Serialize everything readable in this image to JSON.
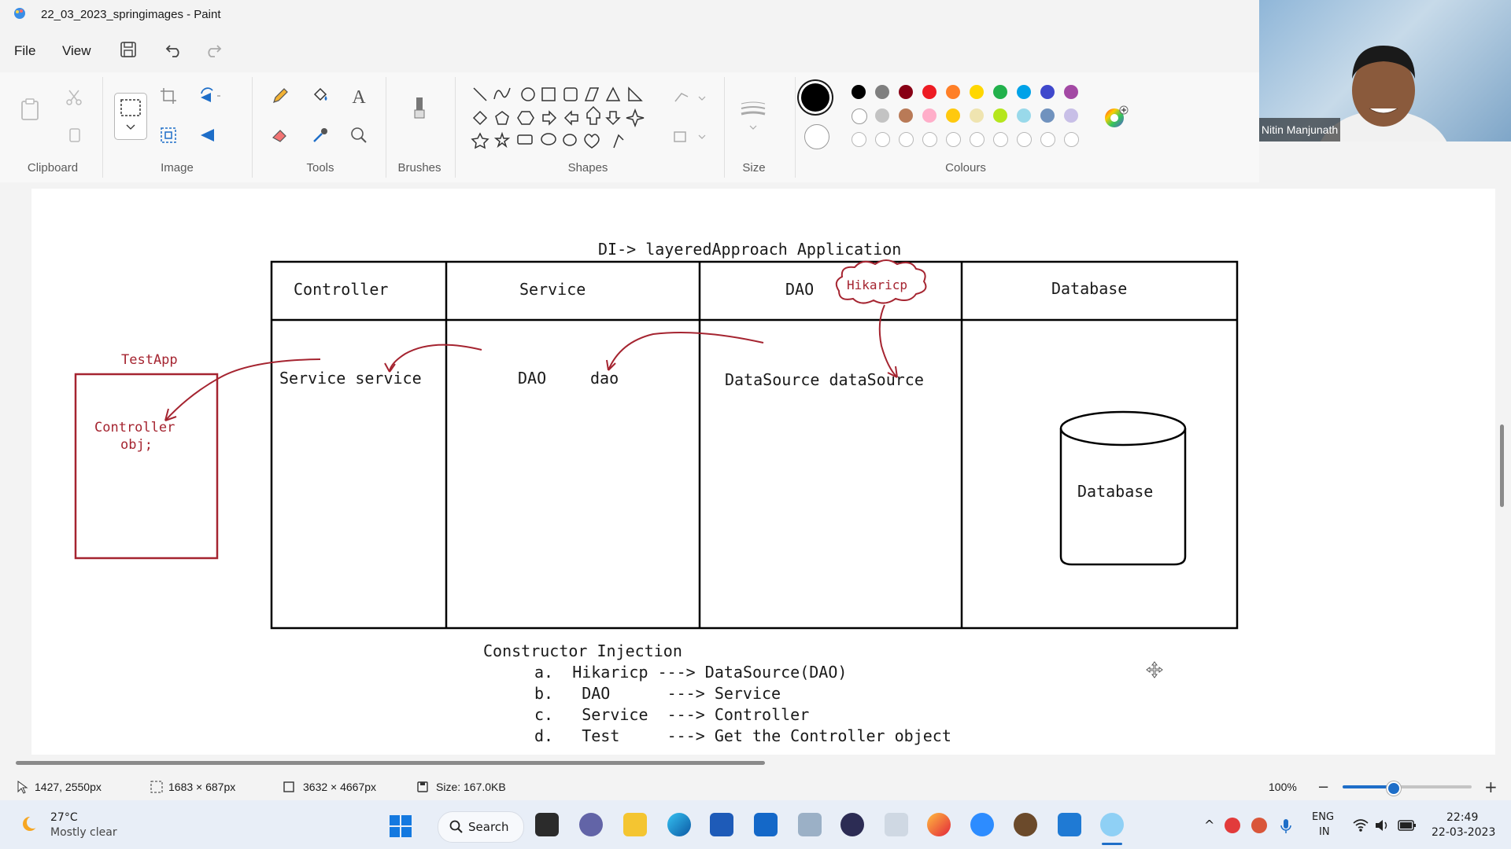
{
  "window": {
    "title": "22_03_2023_springimages - Paint"
  },
  "menu": {
    "file": "File",
    "view": "View"
  },
  "ribbon": {
    "groups": {
      "clipboard": "Clipboard",
      "image": "Image",
      "tools": "Tools",
      "brushes": "Brushes",
      "shapes": "Shapes",
      "size": "Size",
      "colours": "Colours"
    }
  },
  "colors": {
    "row1": [
      "#000000",
      "#7f7f7f",
      "#880015",
      "#ed1c24",
      "#ff7f27",
      "#ffd700",
      "#22b14c",
      "#00a2e8",
      "#3f48cc",
      "#a349a4"
    ],
    "row2": [
      "#ffffff",
      "#c3c3c3",
      "#b97a57",
      "#ffaec9",
      "#ffc90e",
      "#efe4b0",
      "#b5e61d",
      "#99d9ea",
      "#7092be",
      "#c8bfe7"
    ]
  },
  "webcam": {
    "name": "Nitin Manjunath"
  },
  "diagram": {
    "title": "DI-> layeredApproach Application",
    "headers": [
      "Controller",
      "Service",
      "DAO",
      "Database"
    ],
    "hikari": "Hikaricp",
    "testapp_label": "TestApp",
    "controller_obj_line1": "Controller",
    "controller_obj_line2": "obj;",
    "service_field": "Service service",
    "dao_type": "DAO",
    "dao_var": "dao",
    "datasource_field": "DataSource dataSource",
    "database_label": "Database",
    "injection_title": "Constructor Injection",
    "injection_items": [
      {
        "letter": "a.",
        "from": "Hikaricp",
        "arrow": "--->",
        "to": "DataSource(DAO)"
      },
      {
        "letter": "b.",
        "from": "DAO",
        "arrow": "--->",
        "to": "Service"
      },
      {
        "letter": "c.",
        "from": "Service",
        "arrow": "--->",
        "to": "Controller"
      },
      {
        "letter": "d.",
        "from": "Test",
        "arrow": "--->",
        "to": "Get the Controller object"
      }
    ]
  },
  "status": {
    "cursor": "1427, 2550px",
    "selection": "1683 × 687px",
    "canvas_size": "3632 × 4667px",
    "file_size": "Size: 167.0KB",
    "zoom": "100%"
  },
  "taskbar": {
    "weather_temp": "27°C",
    "weather_desc": "Mostly clear",
    "search": "Search",
    "lang1": "ENG",
    "lang2": "IN",
    "time": "22:49",
    "date": "22-03-2023"
  }
}
